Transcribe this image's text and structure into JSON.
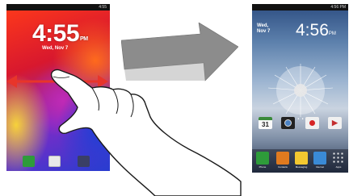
{
  "lock_screen": {
    "time": "4:55",
    "ampm": "PM",
    "date": "Wed, Nov 7",
    "status_bar_text": "4:55"
  },
  "home_screen": {
    "time": "4:56",
    "ampm": "PM",
    "date_line1": "Wed,",
    "date_line2": "Nov 7",
    "status_bar_text": "4:56 PM",
    "calendar_day": "31",
    "page_indicator": "• • • • • • •",
    "dock_labels": [
      "Phone",
      "Contacts",
      "Messaging",
      "Internet",
      "Apps"
    ]
  },
  "colors": {
    "swipe_arrow": "#e8352a",
    "transition_arrow": "#8c8c8c"
  },
  "icons": {
    "lock_dock": [
      "phone-icon",
      "email-icon",
      "camera-icon"
    ],
    "home_apps": [
      "calendar-icon",
      "camera-icon",
      "record-icon",
      "play-store-icon"
    ],
    "home_dock": [
      "phone-icon",
      "contacts-icon",
      "messaging-icon",
      "internet-icon",
      "apps-icon"
    ]
  }
}
